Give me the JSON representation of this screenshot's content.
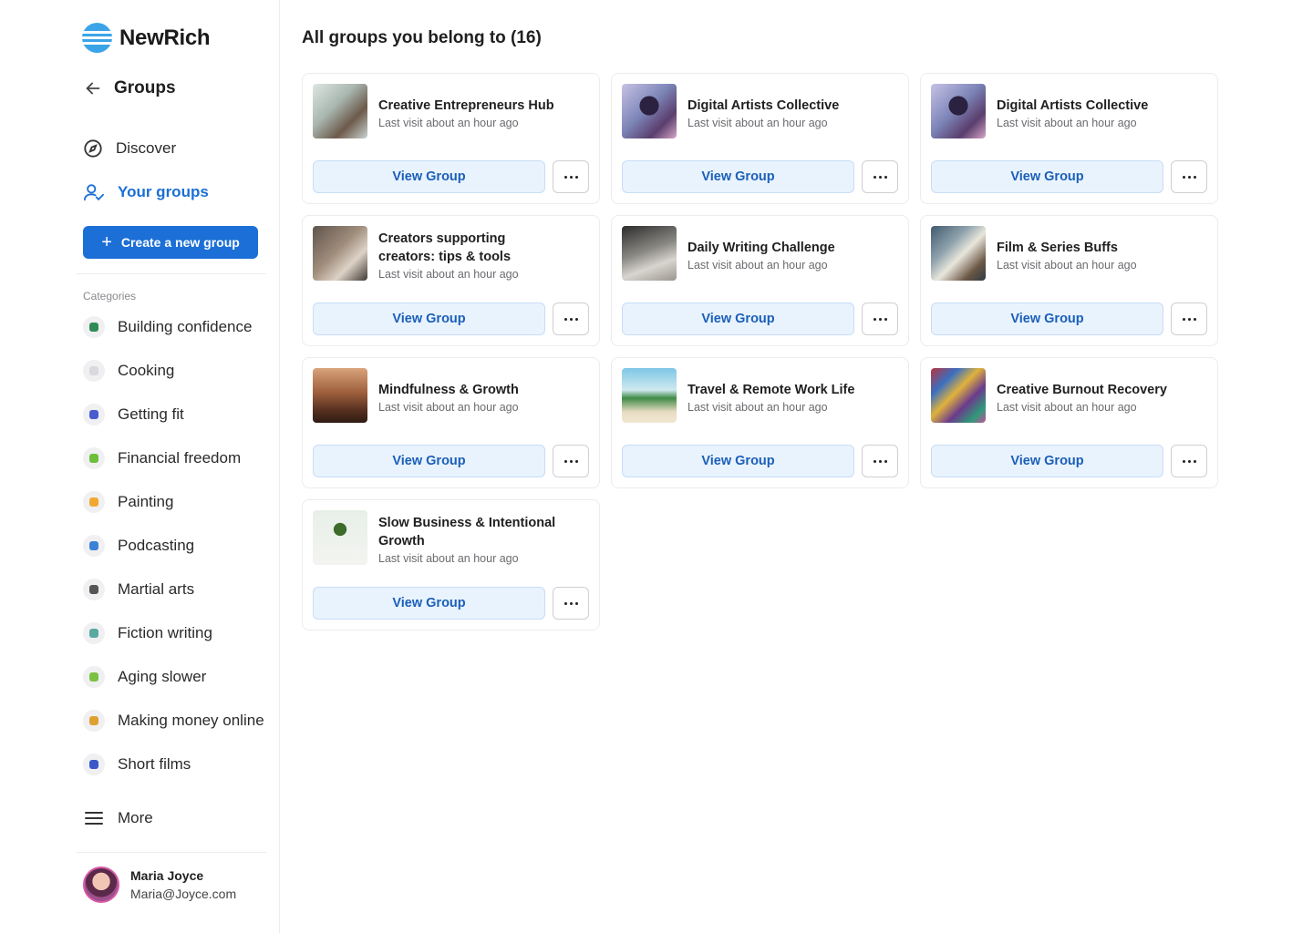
{
  "brand": {
    "name": "NewRich",
    "accent": "#1b6fd6",
    "logo_color": "#3ba4e8"
  },
  "sidebar": {
    "back_title": "Groups",
    "nav": [
      {
        "label": "Discover",
        "icon": "compass-icon",
        "active": false
      },
      {
        "label": "Your groups",
        "icon": "user-check-icon",
        "active": true
      }
    ],
    "create_label": "Create a new group",
    "categories_title": "Categories",
    "categories": [
      {
        "label": "Building confidence",
        "icon": "confidence-icon",
        "color": "#2e8b57"
      },
      {
        "label": "Cooking",
        "icon": "cooking-icon",
        "color": "#d9d9de"
      },
      {
        "label": "Getting fit",
        "icon": "dumbbell-icon",
        "color": "#4a5bd0"
      },
      {
        "label": "Financial freedom",
        "icon": "money-icon",
        "color": "#6cbf3a"
      },
      {
        "label": "Painting",
        "icon": "palette-icon",
        "color": "#f0a830"
      },
      {
        "label": "Podcasting",
        "icon": "microphone-icon",
        "color": "#3b82d6"
      },
      {
        "label": "Martial arts",
        "icon": "martial-arts-icon",
        "color": "#555555"
      },
      {
        "label": "Fiction writing",
        "icon": "ufo-icon",
        "color": "#5aa8a0"
      },
      {
        "label": "Aging slower",
        "icon": "person-icon",
        "color": "#7cc242"
      },
      {
        "label": "Making money online",
        "icon": "laptop-money-icon",
        "color": "#e0a030"
      },
      {
        "label": "Short films",
        "icon": "clapper-icon",
        "color": "#3c57c9"
      }
    ],
    "more_label": "More",
    "profile": {
      "name": "Maria Joyce",
      "email": "Maria@Joyce.com"
    }
  },
  "main": {
    "title": "All groups you belong to (16)",
    "view_label": "View Group",
    "groups": [
      {
        "name": "Creative Entrepreneurs Hub",
        "last_visit": "Last visit about an hour ago",
        "thumb": "office-photo"
      },
      {
        "name": "Digital Artists Collective",
        "last_visit": "Last visit about an hour ago",
        "thumb": "digital-bust-art"
      },
      {
        "name": "Digital Artists Collective",
        "last_visit": "Last visit about an hour ago",
        "thumb": "digital-bust-art"
      },
      {
        "name": "Creators supporting creators: tips & tools",
        "last_visit": "Last visit about an hour ago",
        "thumb": "people-working-photo"
      },
      {
        "name": "Daily Writing Challenge",
        "last_visit": "Last visit about an hour ago",
        "thumb": "fountain-pen-photo"
      },
      {
        "name": "Film & Series Buffs",
        "last_visit": "Last visit about an hour ago",
        "thumb": "clapperboard-photo"
      },
      {
        "name": "Mindfulness & Growth",
        "last_visit": "Last visit about an hour ago",
        "thumb": "meditation-photo"
      },
      {
        "name": "Travel & Remote Work Life",
        "last_visit": "Last visit about an hour ago",
        "thumb": "beach-laptop-photo"
      },
      {
        "name": "Creative Burnout Recovery",
        "last_visit": "Last visit about an hour ago",
        "thumb": "colorful-books-photo"
      },
      {
        "name": "Slow Business & Intentional Growth",
        "last_visit": "Last visit about an hour ago",
        "thumb": "bonsai-photo"
      }
    ]
  }
}
